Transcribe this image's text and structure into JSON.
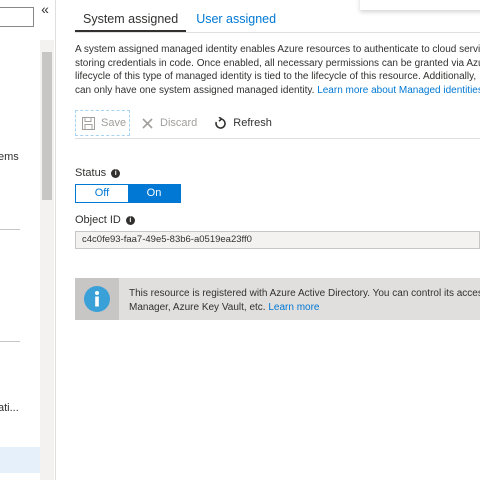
{
  "nav": {
    "collapse_glyph": "«",
    "items": [
      "ems",
      "ati..."
    ]
  },
  "tabs": [
    {
      "label": "System assigned",
      "active": true
    },
    {
      "label": "User assigned",
      "active": false
    }
  ],
  "description": {
    "lines": [
      "A system assigned managed identity enables Azure resources to authenticate to cloud service",
      "storing credentials in code. Once enabled, all necessary permissions can be granted via Azure",
      "lifecycle of this type of managed identity is tied to the lifecycle of this resource. Additionally, ",
      "can only have one system assigned managed identity. "
    ],
    "link": "Learn more about Managed identities."
  },
  "toolbar": {
    "save_label": "Save",
    "discard_label": "Discard",
    "refresh_label": "Refresh"
  },
  "status": {
    "label": "Status",
    "off_label": "Off",
    "on_label": "On",
    "selected": "On"
  },
  "object_id": {
    "label": "Object ID",
    "value": "c4c0fe93-faa7-49e5-83b6-a0519ea23ff0"
  },
  "banner": {
    "line1": "This resource is registered with Azure Active Directory. You can control its access",
    "line2": "Manager, Azure Key Vault, etc. ",
    "link": "Learn more"
  },
  "colors": {
    "accent": "#0078d4",
    "info_icon": "#3aa0d8"
  }
}
